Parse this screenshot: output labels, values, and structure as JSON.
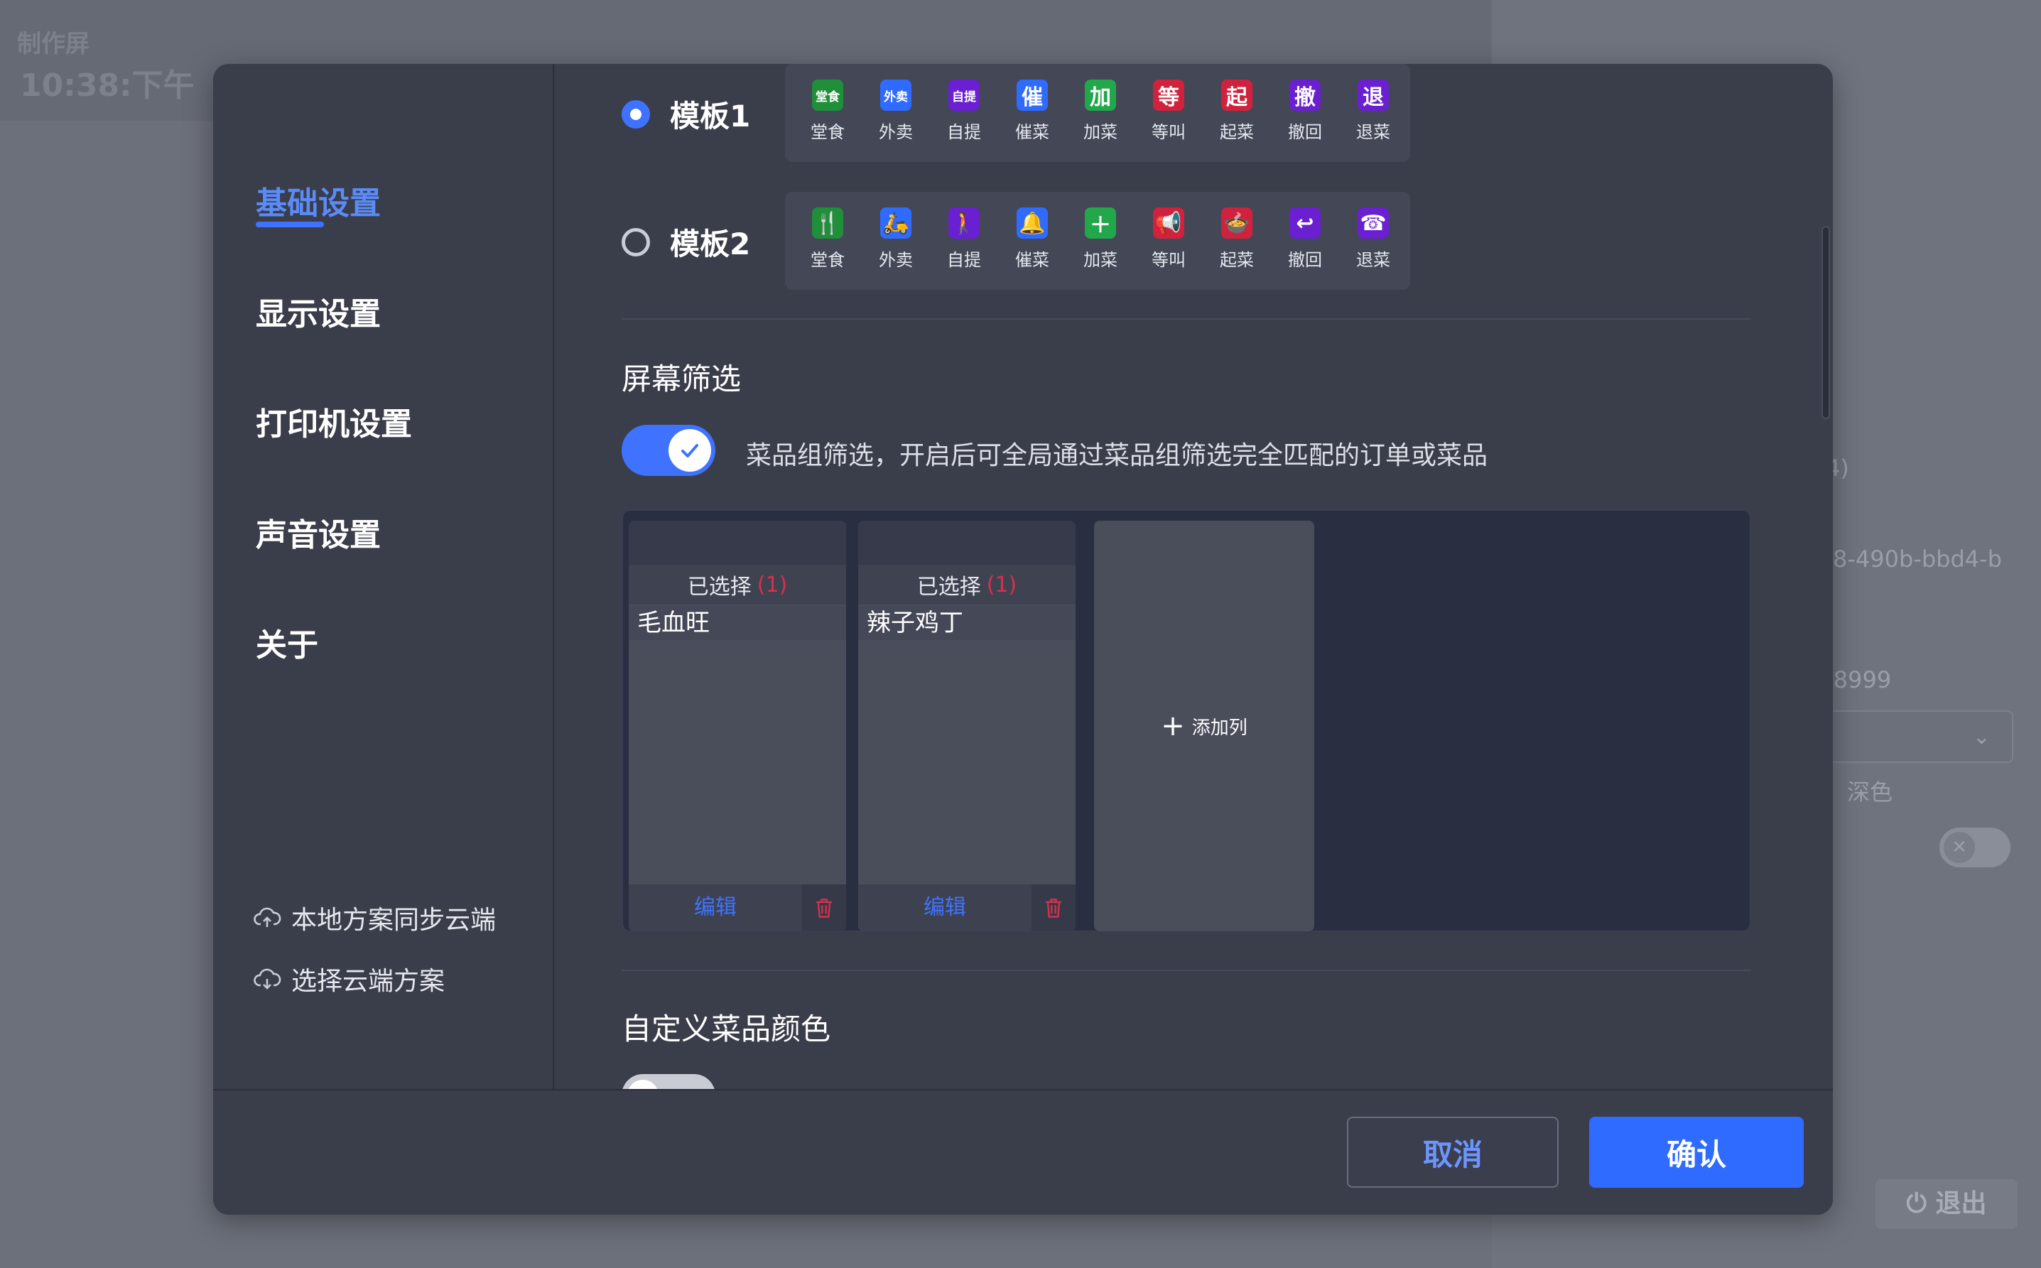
{
  "background": {
    "title": "制作屏",
    "time": "10:38:下午",
    "right_texts": [
      "4)",
      "8-490b-bbd4-b",
      ":8999",
      "深色"
    ],
    "logout_label": "退出"
  },
  "sidebar": {
    "items": [
      {
        "label": "基础设置",
        "active": true
      },
      {
        "label": "显示设置",
        "active": false
      },
      {
        "label": "打印机设置",
        "active": false
      },
      {
        "label": "声音设置",
        "active": false
      },
      {
        "label": "关于",
        "active": false
      }
    ],
    "cloud_sync_label": "本地方案同步云端",
    "cloud_select_label": "选择云端方案"
  },
  "templates": [
    {
      "label": "模板1",
      "selected": true,
      "icons": [
        {
          "glyph": "堂食",
          "caption": "堂食",
          "color": "#1f8f3a",
          "icon": "dine-in-text-icon"
        },
        {
          "glyph": "外卖",
          "caption": "外卖",
          "color": "#2f6bff",
          "icon": "takeout-text-icon"
        },
        {
          "glyph": "自提",
          "caption": "自提",
          "color": "#6a1fd0",
          "icon": "pickup-text-icon"
        },
        {
          "glyph": "催",
          "caption": "催菜",
          "color": "#2f6bff",
          "icon": "urge-text-icon"
        },
        {
          "glyph": "加",
          "caption": "加菜",
          "color": "#22a84a",
          "icon": "add-dish-text-icon"
        },
        {
          "glyph": "等",
          "caption": "等叫",
          "color": "#d0223d",
          "icon": "wait-call-text-icon"
        },
        {
          "glyph": "起",
          "caption": "起菜",
          "color": "#d0223d",
          "icon": "start-dish-text-icon"
        },
        {
          "glyph": "撤",
          "caption": "撤回",
          "color": "#6a1fd0",
          "icon": "withdraw-text-icon"
        },
        {
          "glyph": "退",
          "caption": "退菜",
          "color": "#6a1fd0",
          "icon": "return-dish-text-icon"
        }
      ]
    },
    {
      "label": "模板2",
      "selected": false,
      "icons": [
        {
          "glyph": "🍴",
          "caption": "堂食",
          "color": "#1f8f3a",
          "icon": "fork-knife-icon"
        },
        {
          "glyph": "🛵",
          "caption": "外卖",
          "color": "#2f6bff",
          "icon": "scooter-icon"
        },
        {
          "glyph": "🚶",
          "caption": "自提",
          "color": "#6a1fd0",
          "icon": "pickup-person-icon"
        },
        {
          "glyph": "🔔",
          "caption": "催菜",
          "color": "#2f6bff",
          "icon": "bell-icon"
        },
        {
          "glyph": "＋",
          "caption": "加菜",
          "color": "#22a84a",
          "icon": "plus-dish-icon"
        },
        {
          "glyph": "📢",
          "caption": "等叫",
          "color": "#d0223d",
          "icon": "megaphone-icon"
        },
        {
          "glyph": "🍲",
          "caption": "起菜",
          "color": "#d0223d",
          "icon": "cloche-icon"
        },
        {
          "glyph": "↩",
          "caption": "撤回",
          "color": "#6a1fd0",
          "icon": "undo-arrow-icon"
        },
        {
          "glyph": "☎",
          "caption": "退菜",
          "color": "#6a1fd0",
          "icon": "phone-icon"
        }
      ]
    }
  ],
  "screen_filter": {
    "title": "屏幕筛选",
    "toggle_on": true,
    "description": "菜品组筛选，开启后可全局通过菜品组筛选完全匹配的订单或菜品",
    "columns": [
      {
        "header": "已选择",
        "count": "(1)",
        "items": [
          "毛血旺"
        ],
        "edit_label": "编辑"
      },
      {
        "header": "已选择",
        "count": "(1)",
        "items": [
          "辣子鸡丁"
        ],
        "edit_label": "编辑"
      }
    ],
    "add_column_label": "添加列"
  },
  "custom_color": {
    "title": "自定义菜品颜色",
    "toggle_on": false
  },
  "footer": {
    "cancel_label": "取消",
    "confirm_label": "确认"
  },
  "colors": {
    "accent": "#3f73ff",
    "danger": "#d9304b",
    "modal_bg": "#3a3d4a"
  }
}
